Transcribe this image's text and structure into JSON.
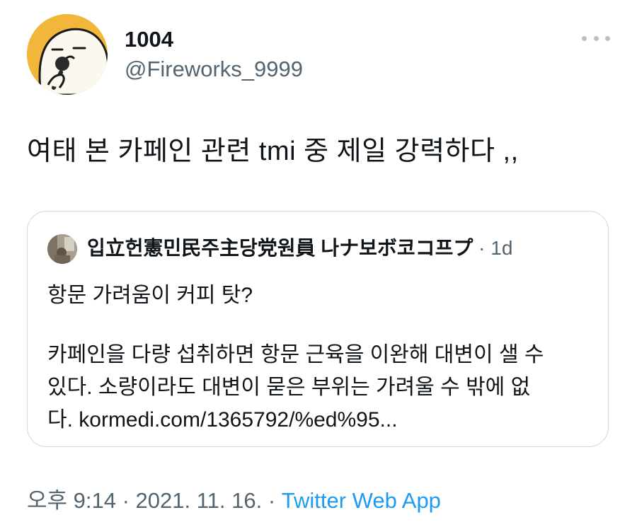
{
  "author": {
    "display_name": "1004",
    "handle": "@Fireworks_9999",
    "avatar_icon": "cartoon-microphone-avatar"
  },
  "tweet": {
    "text": "여태 본 카페인 관련 tmi 중 제일 강력하다 ,,"
  },
  "quoted_tweet": {
    "author_name": "입立헌憲민民주主당党원員 나ナ보ボ코コ프プ",
    "separator": " · ",
    "time_ago": "1d",
    "lines": [
      "항문 가려움이 커피 탓?",
      "카페인을 다량 섭취하면 항문 근육을 이완해 대변이 샐 수",
      "있다. 소량이라도 대변이 묻은 부위는 가려울 수 밖에 없",
      "다. kormedi.com/1365792/%ed%95..."
    ]
  },
  "footer": {
    "timestamp": "오후 9:14 · 2021. 11. 16. · ",
    "source": "Twitter Web App"
  },
  "colors": {
    "text": "#0f1419",
    "secondary": "#536471",
    "link": "#1d9bf0",
    "border": "#cfd9de",
    "avatar_bg": "#f2b63a"
  }
}
